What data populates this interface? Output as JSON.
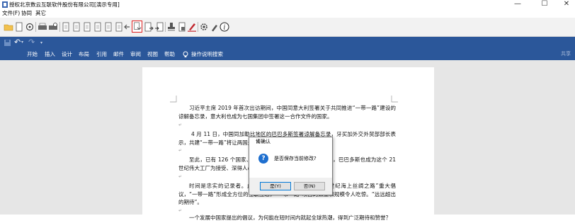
{
  "window": {
    "title": "授权北京数云互联软件股份有限公司[演示专用]",
    "controls": {
      "minimize": "—",
      "maximize": "☐",
      "close": "✕"
    }
  },
  "menu": [
    "文件(F)",
    "协同",
    "其它"
  ],
  "quick_access": {
    "undo_glyph": "↶",
    "redo_glyph": "↷"
  },
  "ribbon": {
    "tabs": [
      "开始",
      "插入",
      "设计",
      "布局",
      "引用",
      "邮件",
      "审阅",
      "视图",
      "帮助"
    ],
    "search_label": "操作说明搜索",
    "share_label": "共享"
  },
  "document": {
    "paragraphs": [
      "习近平主席 2019 年首次出访期间，中国同意大利签署关于共同推进“一带一路”建设的谅解备忘录，意大利也成为七国集团中签署这一合作文件的国家。",
      "4 月 11 日，中国同加勒比地区的巴巴多斯签署谅解备忘录，牙买加外交外贸部部长表示，共建“一带一路”将让两国关系",
      "至此，已有 126 个国家、2 国际组织同中方签署了合作文件，巴巴多斯也成为这个 21 世纪伟大工厂为接受、深得人心的实证。",
      "时间是忠实的记录者。此时，“丝绸之路经济带”和“21 世纪海上丝绸之路”重大倡议，“一带一路”形成全方位的互联互通，“一带一路”项目的数量和规模令人吃惊。“远远超出的期待”。",
      "一个发展中国家提出的倡议，为何能在短时间内就起全球热潮，得到广泛期待和赞誉？"
    ]
  },
  "dialog": {
    "title": "请确认",
    "message": "是否保存当前修改?",
    "yes_label": "是(Y)",
    "no_label": "否(N)"
  },
  "colors": {
    "ribbon": "#2b579a",
    "toolbar": "#f2f2f2",
    "doc_background": "#e6e6e6",
    "highlight": "#e02020",
    "question_icon": "#1e6fcf"
  }
}
